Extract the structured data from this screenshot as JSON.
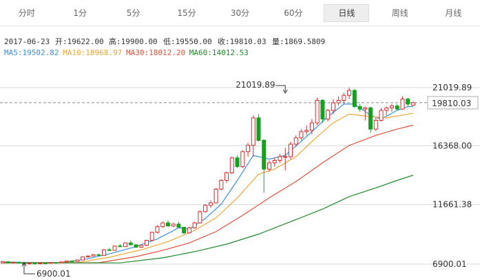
{
  "tabs": [
    "分时",
    "1分",
    "5分",
    "15分",
    "30分",
    "60分",
    "日线",
    "周线",
    "月线"
  ],
  "active_tab": 6,
  "info": {
    "date": "2017-06-23",
    "open_label": "开:19622.00",
    "high_label": "高:19900.00",
    "low_label": "低:19550.00",
    "close_label": "收:19810.03",
    "volume_label": "量:1869.5809"
  },
  "ma_legend": [
    {
      "text": "MA5:19502.82",
      "color": "#3b8fdd"
    },
    {
      "text": "MA10:18968.97",
      "color": "#f0a63a"
    },
    {
      "text": "MA30:18012.20",
      "color": "#e0503a"
    },
    {
      "text": "MA60:14012.53",
      "color": "#1f8a2a"
    }
  ],
  "colors": {
    "up": "#d9292b",
    "down": "#15a020",
    "grid": "#d8d8d8",
    "last": "#888888"
  },
  "chart_data": {
    "type": "candlestick",
    "y_ticks": [
      21019.89,
      16368.0,
      11661.38,
      6900.01
    ],
    "ylim": [
      6900.01,
      21019.89
    ],
    "last_price": 19810.03,
    "last_price_label": "19810.03",
    "annotations": [
      {
        "text": "21019.89",
        "value": 21019.89,
        "at_index": 53
      },
      {
        "text": "6900.01",
        "value": 6900.01,
        "at_index": 4
      }
    ],
    "candles": [
      [
        7000,
        7150,
        6950,
        7100
      ],
      [
        7100,
        7050,
        6950,
        7000
      ],
      [
        7000,
        7100,
        6950,
        7050
      ],
      [
        7050,
        7000,
        6950,
        6980
      ],
      [
        6980,
        6950,
        6900,
        6920
      ],
      [
        6920,
        7000,
        6900,
        6970
      ],
      [
        6970,
        7000,
        6920,
        6940
      ],
      [
        6940,
        7000,
        6930,
        6980
      ],
      [
        6980,
        7010,
        6940,
        6960
      ],
      [
        6960,
        7050,
        6950,
        7030
      ],
      [
        7030,
        7080,
        6990,
        7010
      ],
      [
        7010,
        7100,
        7000,
        7080
      ],
      [
        7080,
        7180,
        7050,
        7150
      ],
      [
        7150,
        7200,
        7080,
        7120
      ],
      [
        7120,
        7250,
        7100,
        7230
      ],
      [
        7230,
        7500,
        7200,
        7480
      ],
      [
        7480,
        7600,
        7420,
        7550
      ],
      [
        7550,
        7700,
        7500,
        7650
      ],
      [
        7650,
        7750,
        7550,
        7600
      ],
      [
        7600,
        8100,
        7580,
        8050
      ],
      [
        8050,
        8200,
        7950,
        8000
      ],
      [
        8000,
        8400,
        7980,
        8350
      ],
      [
        8350,
        8500,
        8250,
        8300
      ],
      [
        8300,
        8650,
        8280,
        8600
      ],
      [
        8600,
        8800,
        8400,
        8450
      ],
      [
        8450,
        8500,
        8200,
        8250
      ],
      [
        8250,
        8450,
        8200,
        8400
      ],
      [
        8400,
        8850,
        8350,
        8800
      ],
      [
        8800,
        9500,
        8750,
        9450
      ],
      [
        9450,
        10000,
        9350,
        9900
      ],
      [
        9900,
        10300,
        9800,
        10200
      ],
      [
        10200,
        10400,
        9900,
        9950
      ],
      [
        9950,
        10200,
        9850,
        10100
      ],
      [
        10100,
        10300,
        9900,
        9850
      ],
      [
        9850,
        9900,
        9300,
        9400
      ],
      [
        9400,
        9900,
        9350,
        9800
      ],
      [
        9800,
        10300,
        9750,
        10200
      ],
      [
        10200,
        11200,
        10150,
        11100
      ],
      [
        11100,
        11700,
        11000,
        11600
      ],
      [
        11600,
        12000,
        11400,
        11800
      ],
      [
        11800,
        13000,
        11750,
        12900
      ],
      [
        12900,
        13700,
        12800,
        13600
      ],
      [
        13600,
        14300,
        13400,
        14200
      ],
      [
        14200,
        15500,
        14100,
        15400
      ],
      [
        15400,
        15600,
        14600,
        14700
      ],
      [
        14700,
        16000,
        14600,
        15900
      ],
      [
        15900,
        16600,
        15500,
        16400
      ],
      [
        16400,
        18800,
        15500,
        18600
      ],
      [
        18600,
        18900,
        16700,
        16800
      ],
      [
        16800,
        16900,
        12600,
        14500
      ],
      [
        14500,
        15200,
        14300,
        15000
      ],
      [
        15000,
        15400,
        14700,
        15200
      ],
      [
        15200,
        15700,
        15000,
        15500
      ],
      [
        15500,
        16200,
        14400,
        15500
      ],
      [
        15500,
        16700,
        15300,
        16500
      ],
      [
        16500,
        17200,
        16300,
        17000
      ],
      [
        17000,
        17700,
        16800,
        17500
      ],
      [
        17500,
        18000,
        17200,
        17600
      ],
      [
        17600,
        18500,
        17300,
        18200
      ],
      [
        18200,
        20200,
        18000,
        20000
      ],
      [
        20000,
        20100,
        18200,
        18500
      ],
      [
        18500,
        19300,
        18300,
        19200
      ],
      [
        19200,
        20100,
        18900,
        19800
      ],
      [
        19800,
        20300,
        19600,
        20000
      ],
      [
        20000,
        20600,
        19700,
        20400
      ],
      [
        20400,
        21019.89,
        20100,
        20800
      ],
      [
        20800,
        20900,
        19400,
        19500
      ],
      [
        19500,
        19700,
        19100,
        19300
      ],
      [
        19300,
        19500,
        18400,
        19400
      ],
      [
        19400,
        19500,
        17400,
        17700
      ],
      [
        17700,
        18600,
        17550,
        18400
      ],
      [
        18400,
        19400,
        18300,
        19200
      ],
      [
        19200,
        19500,
        18800,
        19400
      ],
      [
        19400,
        19700,
        19100,
        19550
      ],
      [
        19550,
        19700,
        19200,
        19300
      ],
      [
        19300,
        20300,
        19250,
        20100
      ],
      [
        20100,
        20200,
        19500,
        19700
      ],
      [
        19622,
        19900,
        19550,
        19810.03
      ]
    ],
    "ma_lines": [
      {
        "name": "MA5",
        "color": "#3b8fdd",
        "values": [
          [
            0,
            7060
          ],
          [
            11,
            7020
          ],
          [
            16,
            7330
          ],
          [
            20,
            7720
          ],
          [
            25,
            8300
          ],
          [
            29,
            8920
          ],
          [
            33,
            9800
          ],
          [
            35,
            9700
          ],
          [
            38,
            10550
          ],
          [
            41,
            11700
          ],
          [
            44,
            13600
          ],
          [
            47,
            15600
          ],
          [
            50,
            15300
          ],
          [
            53,
            15600
          ],
          [
            57,
            17100
          ],
          [
            61,
            18700
          ],
          [
            64,
            19700
          ],
          [
            66,
            19700
          ],
          [
            69,
            18800
          ],
          [
            71,
            18500
          ],
          [
            74,
            19200
          ],
          [
            76,
            19500
          ],
          [
            77,
            19502.82
          ]
        ]
      },
      {
        "name": "MA10",
        "color": "#f0a63a",
        "values": [
          [
            0,
            7020
          ],
          [
            14,
            7020
          ],
          [
            20,
            7450
          ],
          [
            26,
            8050
          ],
          [
            31,
            8700
          ],
          [
            36,
            9600
          ],
          [
            40,
            10600
          ],
          [
            44,
            12200
          ],
          [
            48,
            14100
          ],
          [
            51,
            14500
          ],
          [
            55,
            15500
          ],
          [
            59,
            17100
          ],
          [
            62,
            18200
          ],
          [
            65,
            18900
          ],
          [
            69,
            18700
          ],
          [
            72,
            18600
          ],
          [
            77,
            18968.97
          ]
        ]
      },
      {
        "name": "MA30",
        "color": "#e0503a",
        "values": [
          [
            0,
            7010
          ],
          [
            18,
            7010
          ],
          [
            25,
            7500
          ],
          [
            30,
            8000
          ],
          [
            35,
            8600
          ],
          [
            40,
            9500
          ],
          [
            45,
            10800
          ],
          [
            50,
            12200
          ],
          [
            55,
            13500
          ],
          [
            60,
            15000
          ],
          [
            65,
            16400
          ],
          [
            70,
            17200
          ],
          [
            74,
            17700
          ],
          [
            77,
            18012.2
          ]
        ]
      },
      {
        "name": "MA60",
        "color": "#1f8a2a",
        "values": [
          [
            0,
            7000
          ],
          [
            22,
            7000
          ],
          [
            30,
            7400
          ],
          [
            36,
            7900
          ],
          [
            42,
            8500
          ],
          [
            48,
            9300
          ],
          [
            54,
            10300
          ],
          [
            60,
            11300
          ],
          [
            65,
            12300
          ],
          [
            70,
            13000
          ],
          [
            74,
            13600
          ],
          [
            77,
            14012.53
          ]
        ]
      }
    ]
  }
}
